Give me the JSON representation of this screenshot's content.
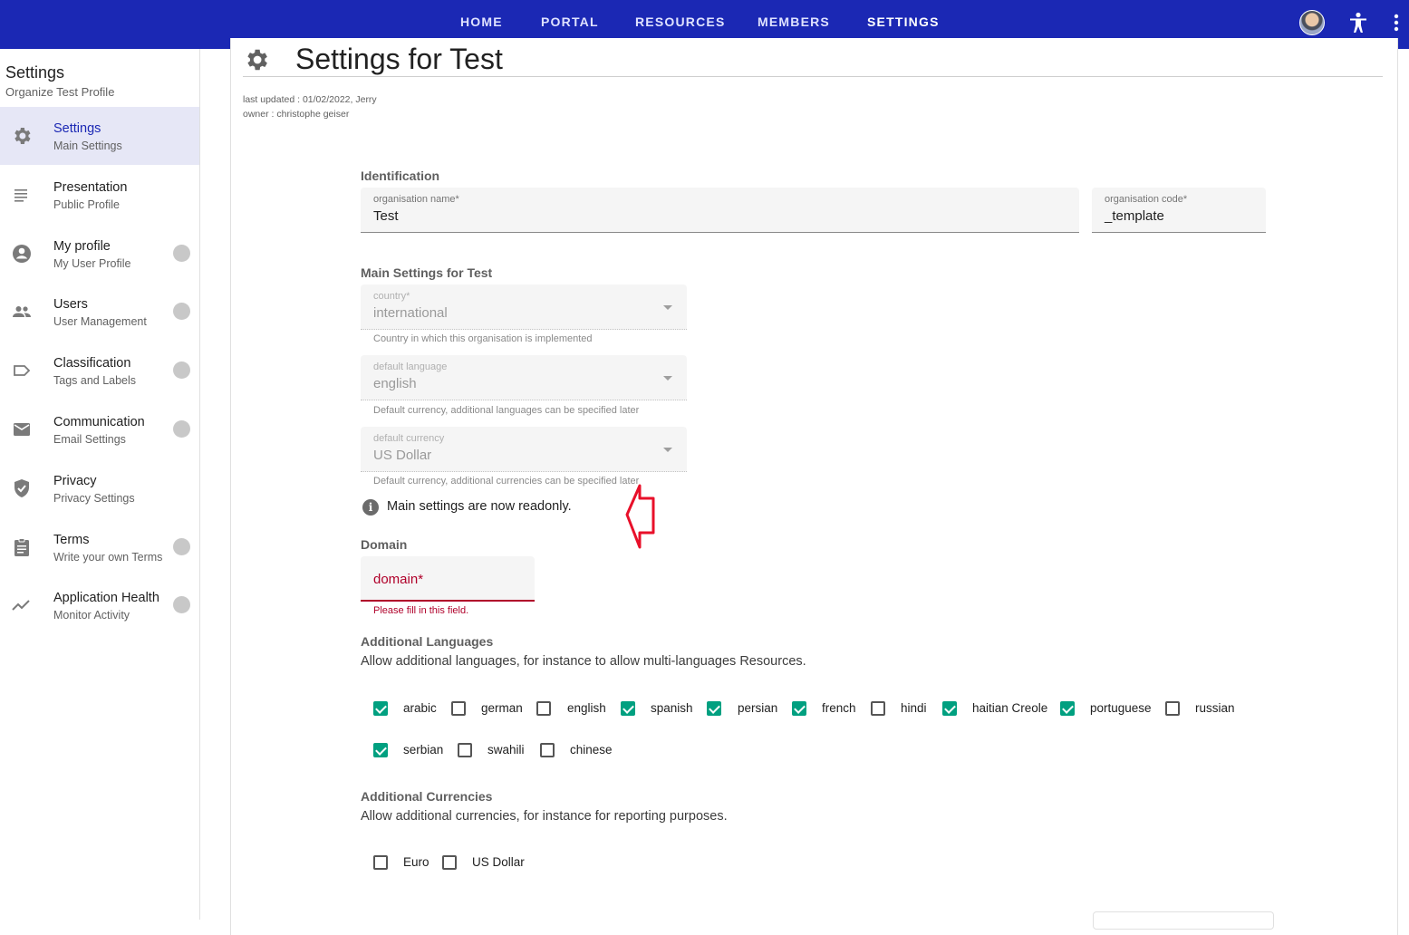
{
  "topnav": {
    "items": [
      "HOME",
      "PORTAL",
      "RESOURCES",
      "MEMBERS",
      "SETTINGS"
    ],
    "active": "SETTINGS"
  },
  "sidebar": {
    "title": "Settings",
    "subtitle": "Organize Test Profile",
    "items": [
      {
        "label": "Settings",
        "desc": "Main Settings",
        "icon": "gear-icon",
        "active": true,
        "wrench": false
      },
      {
        "label": "Presentation",
        "desc": "Public Profile",
        "icon": "lines-icon",
        "active": false,
        "wrench": false
      },
      {
        "label": "My profile",
        "desc": "My User Profile",
        "icon": "account-circle-icon",
        "active": false,
        "wrench": true
      },
      {
        "label": "Users",
        "desc": "User Management",
        "icon": "people-icon",
        "active": false,
        "wrench": true
      },
      {
        "label": "Classification",
        "desc": "Tags and Labels",
        "icon": "label-icon",
        "active": false,
        "wrench": true
      },
      {
        "label": "Communication",
        "desc": "Email Settings",
        "icon": "mail-icon",
        "active": false,
        "wrench": true
      },
      {
        "label": "Privacy",
        "desc": "Privacy Settings",
        "icon": "shield-check-icon",
        "active": false,
        "wrench": false
      },
      {
        "label": "Terms",
        "desc": "Write your own Terms",
        "icon": "clipboard-icon",
        "active": false,
        "wrench": true
      },
      {
        "label": "Application Health",
        "desc": "Monitor Activity",
        "icon": "trending-icon",
        "active": false,
        "wrench": true
      }
    ]
  },
  "page": {
    "title": "Settings for Test",
    "last_updated": "last updated : 01/02/2022, Jerry",
    "owner": "owner : christophe geiser"
  },
  "identification": {
    "heading": "Identification",
    "org_name_label": "organisation name*",
    "org_name_value": "Test",
    "org_code_label": "organisation code*",
    "org_code_value": "_template"
  },
  "main_settings": {
    "heading": "Main Settings for Test",
    "country_label": "country*",
    "country_value": "international",
    "country_hint": "Country in which this organisation is implemented",
    "language_label": "default language",
    "language_value": "english",
    "language_hint": "Default currency, additional languages can be specified later",
    "currency_label": "default currency",
    "currency_value": "US Dollar",
    "currency_hint": "Default currency, additional currencies can be specified later",
    "readonly_notice": "Main settings are now readonly."
  },
  "domain": {
    "heading": "Domain",
    "placeholder": "domain*",
    "error": "Please fill in this field."
  },
  "languages": {
    "heading": "Additional Languages",
    "description": "Allow additional languages, for instance to allow multi-languages Resources.",
    "options": [
      {
        "label": "arabic",
        "checked": true
      },
      {
        "label": "german",
        "checked": false
      },
      {
        "label": "english",
        "checked": false
      },
      {
        "label": "spanish",
        "checked": true
      },
      {
        "label": "persian",
        "checked": true
      },
      {
        "label": "french",
        "checked": true
      },
      {
        "label": "hindi",
        "checked": false
      },
      {
        "label": "haitian Creole",
        "checked": true
      },
      {
        "label": "portuguese",
        "checked": true
      },
      {
        "label": "russian",
        "checked": false
      },
      {
        "label": "serbian",
        "checked": true
      },
      {
        "label": "swahili",
        "checked": false
      },
      {
        "label": "chinese",
        "checked": false
      }
    ]
  },
  "currencies": {
    "heading": "Additional Currencies",
    "description": "Allow additional currencies, for instance for reporting purposes.",
    "options": [
      {
        "label": "Euro",
        "checked": false
      },
      {
        "label": "US Dollar",
        "checked": false
      }
    ]
  },
  "colors": {
    "topbar": "#1b28b4",
    "accent_check": "#00a080",
    "error": "#b0002a",
    "annotation_arrow": "#e8102a"
  }
}
